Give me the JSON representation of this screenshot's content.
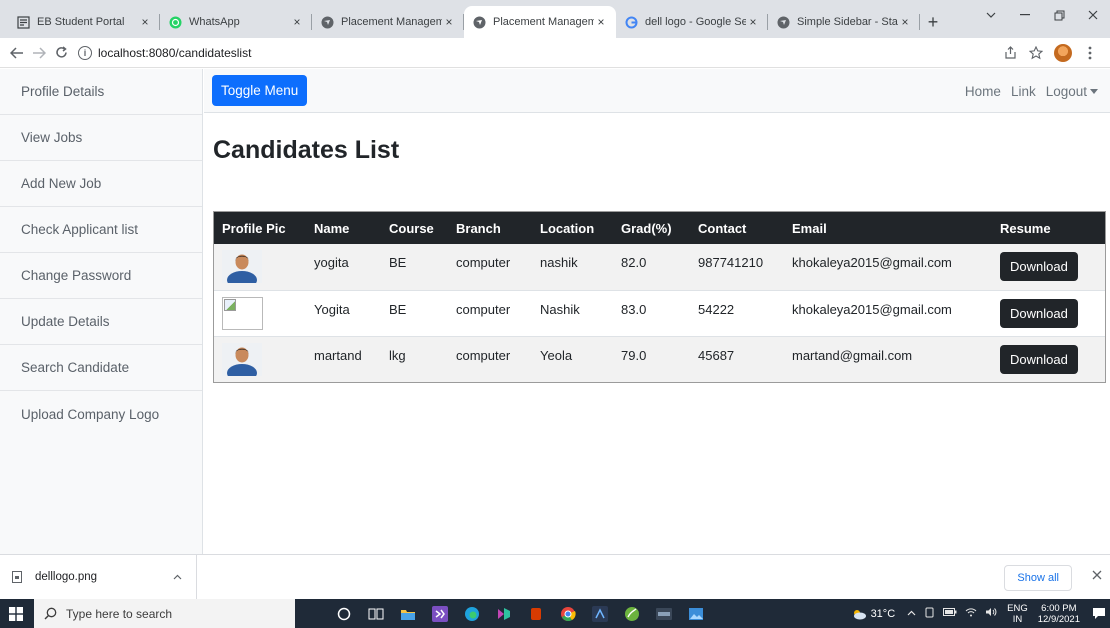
{
  "browser": {
    "tabs": [
      {
        "title": "EB Student Portal",
        "icon": "student-portal-icon",
        "active": false
      },
      {
        "title": "WhatsApp",
        "icon": "whatsapp-icon",
        "active": false
      },
      {
        "title": "Placement Manageme",
        "icon": "globe-icon",
        "active": false
      },
      {
        "title": "Placement Manageme",
        "icon": "globe-icon",
        "active": true
      },
      {
        "title": "dell logo - Google Sea",
        "icon": "google-icon",
        "active": false
      },
      {
        "title": "Simple Sidebar - Start",
        "icon": "globe-icon",
        "active": false
      }
    ],
    "new_tab_label": "+",
    "close_glyph": "×",
    "url": "localhost:8080/candidateslist"
  },
  "sidebar": {
    "items": [
      {
        "label": "Profile Details"
      },
      {
        "label": "View Jobs"
      },
      {
        "label": "Add New Job"
      },
      {
        "label": "Check Applicant list"
      },
      {
        "label": "Change Password"
      },
      {
        "label": "Update Details"
      },
      {
        "label": "Search Candidate"
      },
      {
        "label": "Upload Company Logo"
      }
    ]
  },
  "topnav": {
    "toggle_label": "Toggle Menu",
    "home_label": "Home",
    "link_label": "Link",
    "logout_label": "Logout"
  },
  "page": {
    "title": "Candidates List"
  },
  "table": {
    "headers": [
      "Profile Pic",
      "Name",
      "Course",
      "Branch",
      "Location",
      "Grad(%)",
      "Contact",
      "Email",
      "Resume"
    ],
    "rows": [
      {
        "pic": "photo",
        "name": "yogita",
        "course": "BE",
        "branch": "computer",
        "location": "nashik",
        "grad": "82.0",
        "contact": "987741210",
        "email": "khokaleya2015@gmail.com",
        "resume": "Download"
      },
      {
        "pic": "broken",
        "name": "Yogita",
        "course": "BE",
        "branch": "computer",
        "location": "Nashik",
        "grad": "83.0",
        "contact": "54222",
        "email": "khokaleya2015@gmail.com",
        "resume": "Download"
      },
      {
        "pic": "photo",
        "name": "martand",
        "course": "lkg",
        "branch": "computer",
        "location": "Yeola",
        "grad": "79.0",
        "contact": "45687",
        "email": "martand@gmail.com",
        "resume": "Download"
      }
    ]
  },
  "download_shelf": {
    "file_name": "delllogo.png",
    "show_all_label": "Show all"
  },
  "taskbar": {
    "search_placeholder": "Type here to search",
    "temperature": "31°C",
    "lang_line1": "ENG",
    "lang_line2": "IN",
    "time": "6:00 PM",
    "date": "12/9/2021"
  },
  "colors": {
    "primary_button": "#0d6efd",
    "table_header": "#212529",
    "sidebar_bg": "#f8f9fa",
    "taskbar_bg": "#1f2a38"
  }
}
